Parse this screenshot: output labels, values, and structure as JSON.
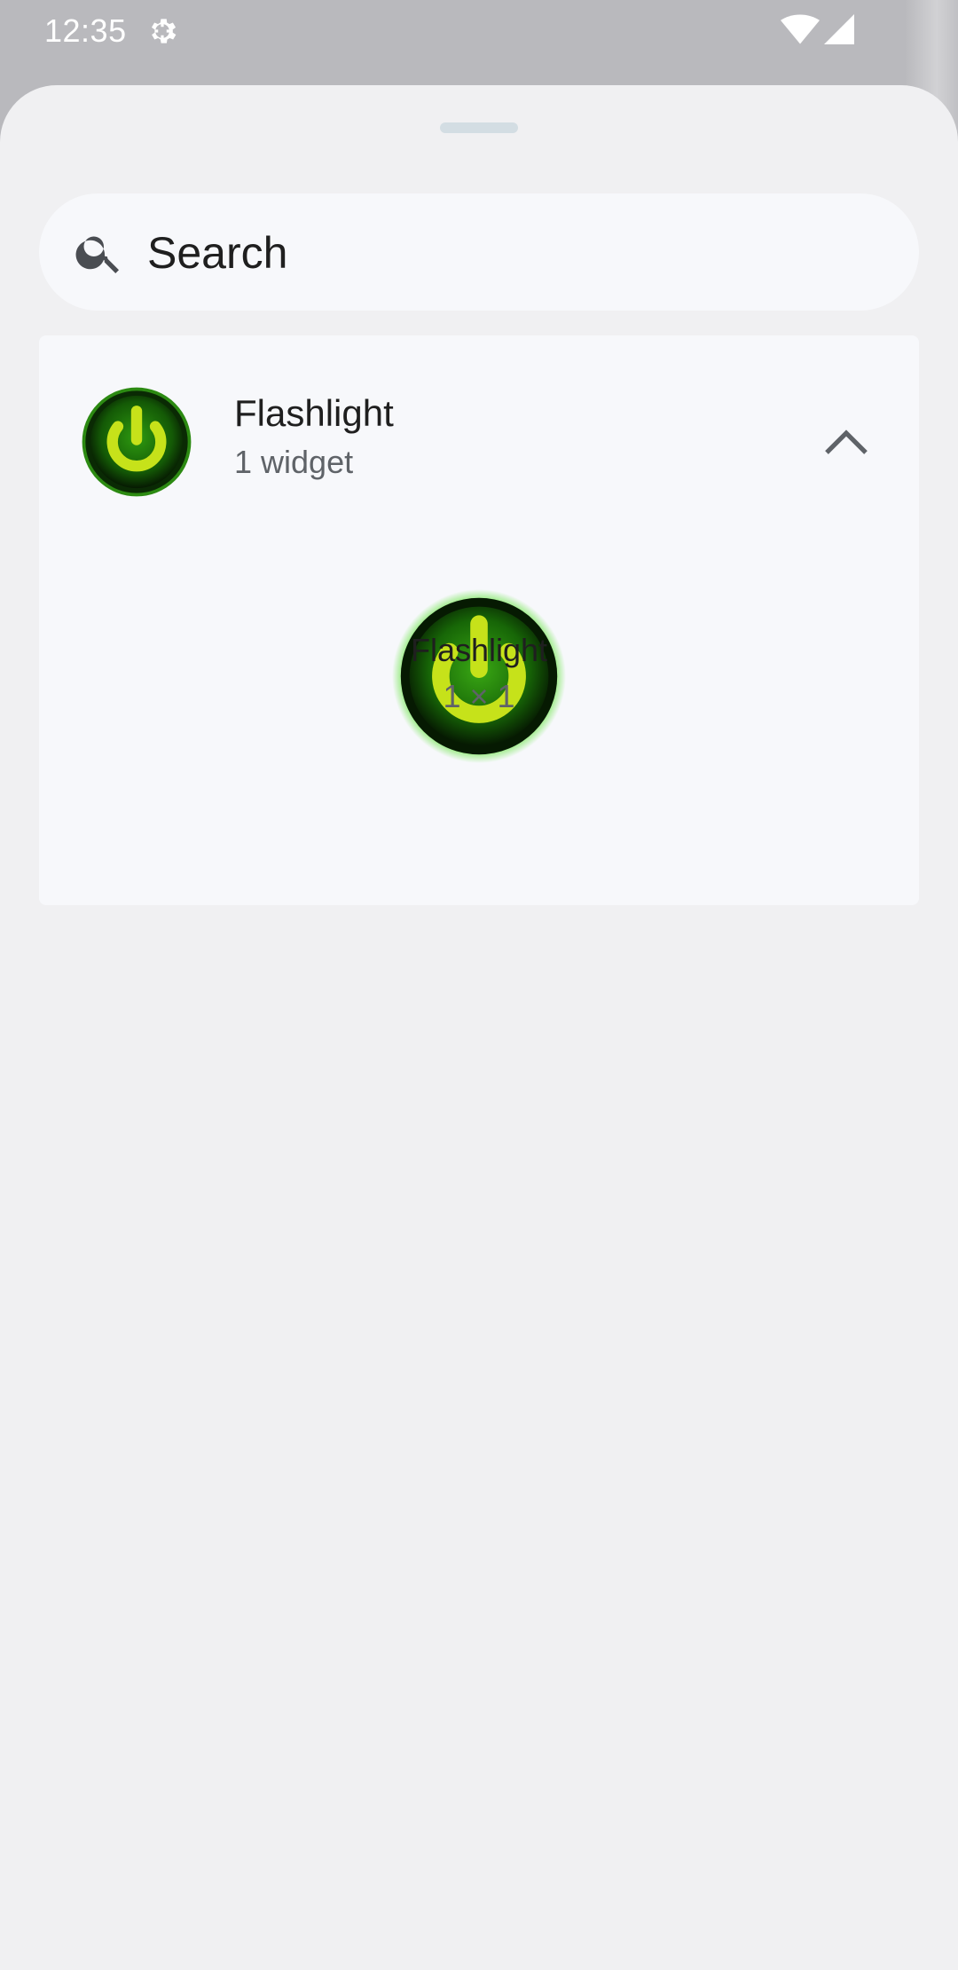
{
  "status_bar": {
    "time": "12:35",
    "icons": [
      "gear-icon",
      "wifi-icon",
      "signal-icon"
    ]
  },
  "search": {
    "placeholder": "Search"
  },
  "app_group": {
    "title": "Flashlight",
    "subtitle": "1 widget",
    "icon": "power-icon",
    "expanded": true
  },
  "widget": {
    "name": "Flashlight",
    "size": "1 × 1",
    "icon": "power-icon"
  },
  "colors": {
    "sheet_bg": "#f0f0f2",
    "card_bg": "#f7f8fb",
    "accent_green": "#3bbf16",
    "icon_yellow": "#c6e21a"
  }
}
